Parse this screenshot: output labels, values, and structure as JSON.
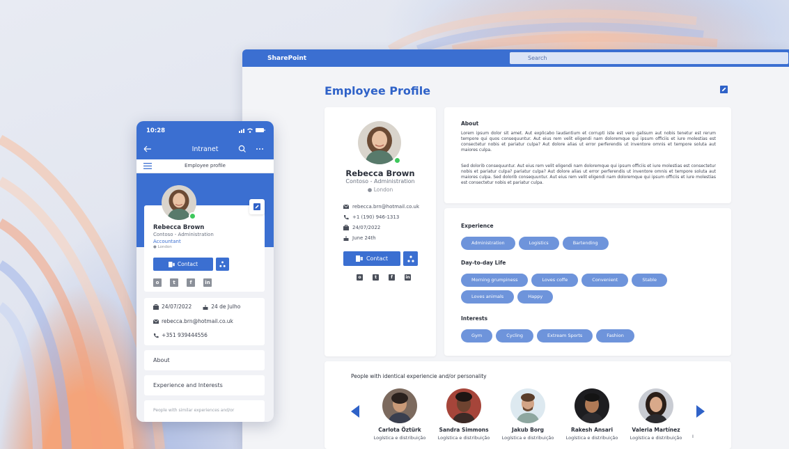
{
  "desktop": {
    "brand": "SharePoint",
    "search_placeholder": "Search",
    "page_title": "Employee Profile",
    "profile": {
      "name": "Rebecca Brown",
      "org": "Contoso - Administration",
      "location": "London",
      "email": "rebecca.brn@hotmail.co.uk",
      "phone": "+1 (190) 946-1313",
      "start_date": "24/07/2022",
      "birthday": "June 24th",
      "contact_label": "Contact"
    },
    "about": {
      "title": "About",
      "paragraph1": "Lorem ipsum dolor sit amet. Aut explicabo laudantium et corrupti iste est vero galisum aut nobis tenetur est rerum tempore qui quos consequuntur. Aut eius rem velit eligendi nam doloremque qui ipsum officiis et iure molestias est consectetur nobis et pariatur culpa? Aut dolore alias ut error perferendis ut inventore omnis et tempore soluta aut maiores culpa.",
      "paragraph2": "Sed dolorib consequuntur. Aut eius rem velit eligendi nam doloremque qui ipsum officiis et iure molestias est consectetur nobis et pariatur culpa? pariatur culpa? Aut dolore alias ut error perferendis ut inventore omnis et tempore soluta aut maiores culpa. Sed dolorib consequuntur. Aut eius rem velit eligendi nam doloremque qui ipsum officiis et iure molestias est consectetur nobis et pariatur culpa."
    },
    "experience": {
      "title": "Experience",
      "tags": [
        "Administration",
        "Logistics",
        "Bartending"
      ]
    },
    "daytoday": {
      "title": "Day-to-day Life",
      "tags": [
        "Morning grumpiness",
        "Loves coffe",
        "Convenient",
        "Stable",
        "Loves animals",
        "Happy"
      ]
    },
    "interests": {
      "title": "Interests",
      "tags": [
        "Gym",
        "Cycling",
        "Extream Sports",
        "Fashion"
      ]
    },
    "people": {
      "title": "People with identical experiencie and/or personality",
      "list": [
        {
          "name": "Carlota Öztürk",
          "role": "Logística e distribuição"
        },
        {
          "name": "Sandra Simmons",
          "role": "Logística e distribuição"
        },
        {
          "name": "Jakub Borg",
          "role": "Logística e distribuição"
        },
        {
          "name": "Rakesh Ansari",
          "role": "Logística e distribuição"
        },
        {
          "name": "Valeria Martínez",
          "role": "Logística e distribuição"
        }
      ],
      "trailing": "I"
    }
  },
  "mobile": {
    "time": "10:28",
    "nav_title": "Intranet",
    "subtitle": "Employee profile",
    "name": "Rebecca Brown",
    "org": "Contoso - Administration",
    "role": "Accountant",
    "location": "London",
    "contact_label": "Contact",
    "start_date": "24/07/2022",
    "birthday": "24 de Julho",
    "email": "rebecca.brn@hotmail.co.uk",
    "phone": "+351 939444556",
    "about_label": "About",
    "exp_label": "Experience and Interests",
    "similar_label": "People with similar experiences and/or"
  },
  "colors": {
    "accent": "#3b6fd1",
    "chip": "#6e94db",
    "title": "#2f62c8",
    "online": "#3ec85c"
  }
}
